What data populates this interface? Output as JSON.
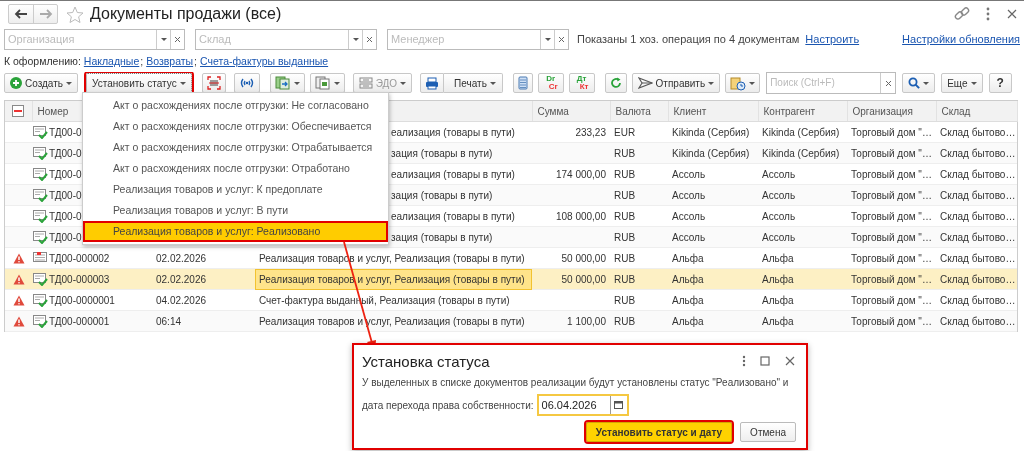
{
  "window": {
    "title": "Документы продажи (все)"
  },
  "filters": [
    {
      "placeholder": "Организация"
    },
    {
      "placeholder": "Склад"
    },
    {
      "placeholder": "Менеджер"
    }
  ],
  "filter_info": "Показаны 1 хоз. операция по 4 документам",
  "filter_link": "Настроить",
  "refresh_settings_link": "Настройки обновления",
  "todo": {
    "label": "К оформлению:",
    "separator": ";",
    "links": [
      "Накладные",
      "Возвраты",
      "Счета-фактуры выданные"
    ]
  },
  "toolbar": [
    {
      "kind": "button",
      "label": "Создать",
      "caret": true
    },
    {
      "kind": "button",
      "label": "Установить статус",
      "caret": true,
      "highlighted": true
    },
    {
      "kind": "icon"
    },
    {
      "kind": "icon"
    },
    {
      "kind": "icon",
      "caret": true
    },
    {
      "kind": "icon",
      "caret": true
    },
    {
      "kind": "button",
      "label": "ЭДО",
      "caret": true,
      "disabled": true
    },
    {
      "kind": "icon"
    },
    {
      "kind": "button",
      "label": "Печать",
      "caret": true
    },
    {
      "kind": "icon"
    },
    {
      "kind": "letters",
      "top": "Dr",
      "bottom": "Cr"
    },
    {
      "kind": "letters",
      "top": "Дт",
      "bottom": "Кт"
    },
    {
      "kind": "icon"
    },
    {
      "kind": "button",
      "label": "Отправить",
      "caret": true
    },
    {
      "kind": "icon",
      "caret": true
    }
  ],
  "search": {
    "placeholder": "Поиск (Ctrl+F)"
  },
  "more_button": "Еще",
  "help_button": "?",
  "table": {
    "columns": [
      {},
      {
        "label": "Номер"
      },
      {},
      {},
      {
        "label": "Сумма"
      },
      {
        "label": "Валюта"
      },
      {
        "label": "Клиент"
      },
      {
        "label": "Контрагент"
      },
      {
        "label": "Организация"
      },
      {
        "label": "Склад"
      }
    ],
    "rows": [
      {
        "warning": false,
        "posted": true,
        "selected": false,
        "number": "ТД00-0",
        "document": "еализация (товары в пути)",
        "sum": "233,23",
        "currency": "EUR",
        "client": "Kikinda (Сербия)",
        "counterparty": "Kikinda (Сербия)",
        "organization": "Торговый дом \"…",
        "warehouse": "Склад бытово…"
      },
      {
        "warning": false,
        "posted": true,
        "selected": false,
        "number": "ТД00-0",
        "document": "зация (товары в пути)",
        "currency": "RUB",
        "client": "Kikinda (Сербия)",
        "counterparty": "Kikinda (Сербия)",
        "organization": "Торговый дом \"…",
        "warehouse": "Склад бытово…"
      },
      {
        "warning": false,
        "posted": true,
        "selected": false,
        "number": "ТД00-0",
        "document": "еализация (товары в пути)",
        "sum": "174 000,00",
        "currency": "RUB",
        "client": "Ассоль",
        "counterparty": "Ассоль",
        "organization": "Торговый дом \"…",
        "warehouse": "Склад бытово…"
      },
      {
        "warning": false,
        "posted": true,
        "selected": false,
        "number": "ТД00-0",
        "document": "зация (товары в пути)",
        "currency": "RUB",
        "client": "Ассоль",
        "counterparty": "Ассоль",
        "organization": "Торговый дом \"…",
        "warehouse": "Склад бытово…"
      },
      {
        "warning": false,
        "posted": true,
        "selected": false,
        "number": "ТД00-0",
        "document": "еализация (товары в пути)",
        "sum": "108 000,00",
        "currency": "RUB",
        "client": "Ассоль",
        "counterparty": "Ассоль",
        "organization": "Торговый дом \"…",
        "warehouse": "Склад бытово…"
      },
      {
        "warning": false,
        "posted": true,
        "selected": false,
        "number": "ТД00-0",
        "document": "зация (товары в пути)",
        "currency": "RUB",
        "client": "Ассоль",
        "counterparty": "Ассоль",
        "organization": "Торговый дом \"…",
        "warehouse": "Склад бытово…"
      },
      {
        "warning": true,
        "posted": false,
        "selected": false,
        "number": "ТД00-000002",
        "date": "02.02.2026",
        "document": "Реализация товаров и услуг, Реализация (товары в пути)",
        "sum": "50 000,00",
        "currency": "RUB",
        "client": "Альфа",
        "counterparty": "Альфа",
        "organization": "Торговый дом \"…",
        "warehouse": "Склад бытово…"
      },
      {
        "warning": true,
        "posted": true,
        "selected": true,
        "number": "ТД00-000003",
        "date": "02.02.2026",
        "document": "Реализация товаров и услуг, Реализация (товары в пути)",
        "sum": "50 000,00",
        "currency": "RUB",
        "client": "Альфа",
        "counterparty": "Альфа",
        "organization": "Торговый дом \"…",
        "warehouse": "Склад бытово…"
      },
      {
        "warning": true,
        "posted": true,
        "selected": false,
        "number": "ТД00-0000001",
        "date": "04.02.2026",
        "document": "Счет-фактура выданный, Реализация (товары в пути)",
        "currency": "RUB",
        "client": "Альфа",
        "counterparty": "Альфа",
        "organization": "Торговый дом \"…",
        "warehouse": "Склад бытово…"
      },
      {
        "warning": true,
        "posted": true,
        "selected": false,
        "number": "ТД00-000001",
        "date": "06:14",
        "document": "Реализация товаров и услуг, Реализация (товары в пути)",
        "sum": "1 100,00",
        "currency": "RUB",
        "client": "Альфа",
        "counterparty": "Альфа",
        "organization": "Торговый дом \"…",
        "warehouse": "Склад бытово…"
      }
    ]
  },
  "status_menu": [
    {
      "label": "Акт о расхождениях после отгрузки: Не согласовано",
      "selected": false
    },
    {
      "label": "Акт о расхождениях после отгрузки: Обеспечивается",
      "selected": false
    },
    {
      "label": "Акт о расхождениях после отгрузки: Отрабатывается",
      "selected": false
    },
    {
      "label": "Акт о расхождениях после отгрузки: Отработано",
      "selected": false
    },
    {
      "label": "Реализация товаров и услуг: К предоплате",
      "selected": false
    },
    {
      "label": "Реализация товаров и услуг: В пути",
      "selected": false
    },
    {
      "label": "Реализация товаров и услуг: Реализовано",
      "selected": true
    }
  ],
  "dialog": {
    "title": "Установка статуса",
    "highlighted": true,
    "message": "У выделенных в списке документов реализации будут установлены статус \"Реализовано\" и",
    "date_label": "дата перехода права собственности:",
    "date_value": "06.04.2026",
    "buttons": [
      {
        "label": "Установить статус и дату",
        "primary": true,
        "highlighted": true
      },
      {
        "label": "Отмена",
        "primary": false,
        "highlighted": false
      }
    ]
  }
}
